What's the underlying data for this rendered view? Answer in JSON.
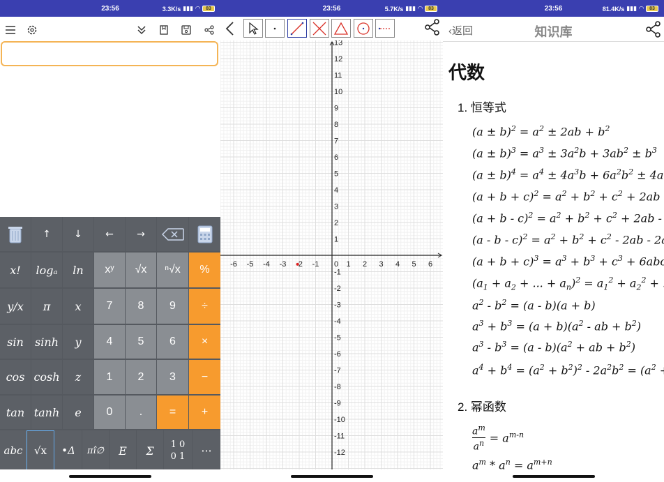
{
  "status_bars": [
    {
      "time": "23:56",
      "speed": "3.3K/s",
      "battery": "83"
    },
    {
      "time": "23:56",
      "speed": "5.7K/s",
      "battery": "83"
    },
    {
      "time": "23:56",
      "speed": "81.4K/s",
      "battery": "83"
    }
  ],
  "calculator": {
    "toolbar_icons": [
      "menu-icon",
      "settings-icon",
      "collapse-icon",
      "bookmark-icon",
      "save-icon",
      "share-icon"
    ],
    "input_value": "",
    "nav_row": [
      "trash-icon",
      "↑",
      "↓",
      "←",
      "→",
      "backspace-icon",
      "calculator-icon"
    ],
    "rows": [
      [
        "x!",
        "logₐ",
        "ln",
        "xʸ",
        "√x",
        "ⁿ√x",
        "%"
      ],
      [
        "y/x",
        "π",
        "x",
        "7",
        "8",
        "9",
        "÷"
      ],
      [
        "sin",
        "sinh",
        "y",
        "4",
        "5",
        "6",
        "×"
      ],
      [
        "cos",
        "cosh",
        "z",
        "1",
        "2",
        "3",
        "−"
      ],
      [
        "tan",
        "tanh",
        "e",
        "0",
        ".",
        "=",
        "+"
      ]
    ],
    "bottom_row": [
      "abc",
      "√x",
      "•Δ",
      "πî∅",
      "E",
      "Σ",
      "1 0\n0 1",
      "···"
    ]
  },
  "graph": {
    "x_ticks": [
      "-6",
      "-5",
      "-4",
      "-3",
      "-2",
      "-1",
      "0",
      "1",
      "2",
      "3",
      "4",
      "5",
      "6"
    ],
    "y_ticks_pos": [
      "1",
      "2",
      "3",
      "4",
      "5",
      "6",
      "7",
      "8",
      "9",
      "10",
      "11",
      "12",
      "13"
    ],
    "y_ticks_neg": [
      "-1",
      "-2",
      "-3",
      "-4",
      "-5",
      "-6",
      "-7",
      "-8",
      "-9",
      "-10",
      "-11",
      "-12"
    ],
    "point": {
      "x": -2.1,
      "y": -0.55
    },
    "tools": [
      "back-icon",
      "select-tool-icon",
      "point-tool-icon",
      "line-tool-icon",
      "intersect-tool-icon",
      "polygon-tool-icon",
      "circle-tool-icon",
      "more-tool-icon",
      "share-icon"
    ]
  },
  "knowledge": {
    "back_label": "返回",
    "title": "知识库",
    "heading": "代数",
    "section1": "1. 恒等式",
    "section2": "2. 幂函数"
  }
}
